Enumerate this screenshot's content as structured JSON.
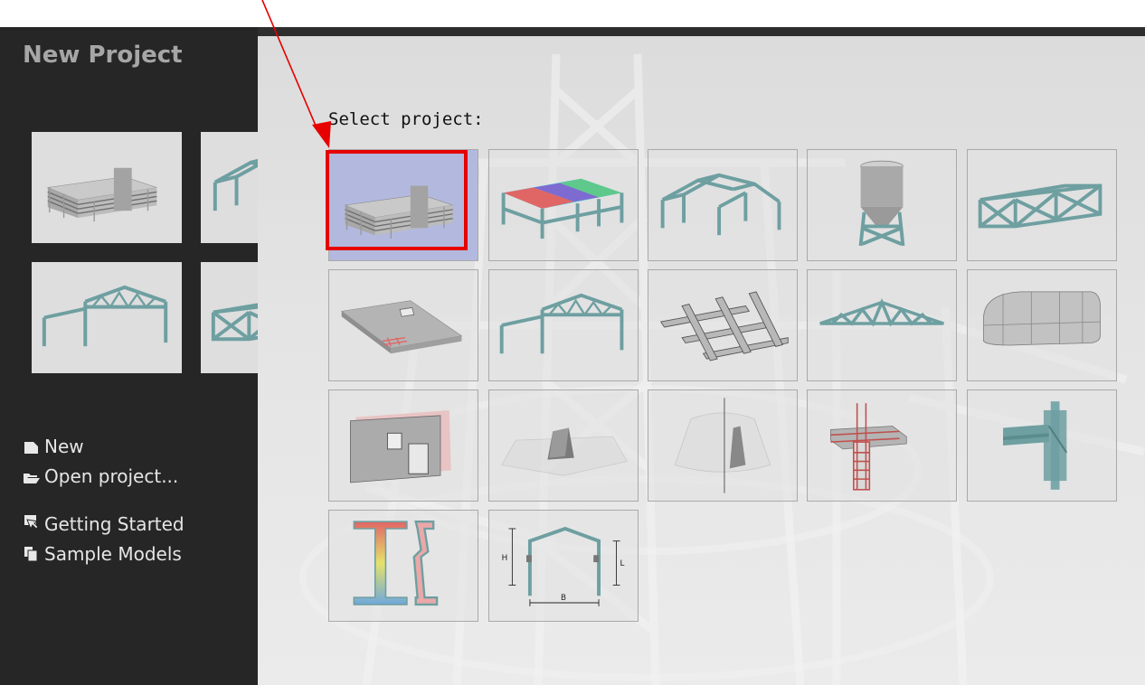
{
  "sidebar": {
    "title": "New Project",
    "recent_projects": [
      "multi-storey building",
      "steel portal frame",
      "portal frame with truss",
      "space truss"
    ],
    "menu": [
      {
        "label": "New",
        "icon": "new-document-icon"
      },
      {
        "label": "Open project...",
        "icon": "open-folder-icon"
      },
      {
        "label": "Getting Started",
        "icon": "getting-started-icon"
      },
      {
        "label": "Sample Models",
        "icon": "sample-models-icon"
      }
    ]
  },
  "main": {
    "prompt": "Select project:",
    "selected_index": 0,
    "templates": [
      {
        "name": "building-icon"
      },
      {
        "name": "frame-with-slabs-icon"
      },
      {
        "name": "industrial-hall-icon"
      },
      {
        "name": "silo-icon"
      },
      {
        "name": "space-truss-icon"
      },
      {
        "name": "slab-with-opening-icon"
      },
      {
        "name": "portal-frame-truss-icon"
      },
      {
        "name": "grillage-icon"
      },
      {
        "name": "plane-truss-icon"
      },
      {
        "name": "curved-wall-icon"
      },
      {
        "name": "wall-with-opening-icon"
      },
      {
        "name": "foundation-block-icon"
      },
      {
        "name": "axisymmetric-shell-icon"
      },
      {
        "name": "rc-column-beam-joint-icon"
      },
      {
        "name": "steel-connection-icon"
      },
      {
        "name": "cross-section-icon"
      },
      {
        "name": "frame-dimensions-icon",
        "dim_labels": [
          "H",
          "L",
          "B"
        ]
      }
    ]
  },
  "colors": {
    "sidebar_bg": "#262626",
    "member_teal": "#6e9fa1",
    "selection_fill": "#b3b9de",
    "highlight_red": "#e60000"
  }
}
